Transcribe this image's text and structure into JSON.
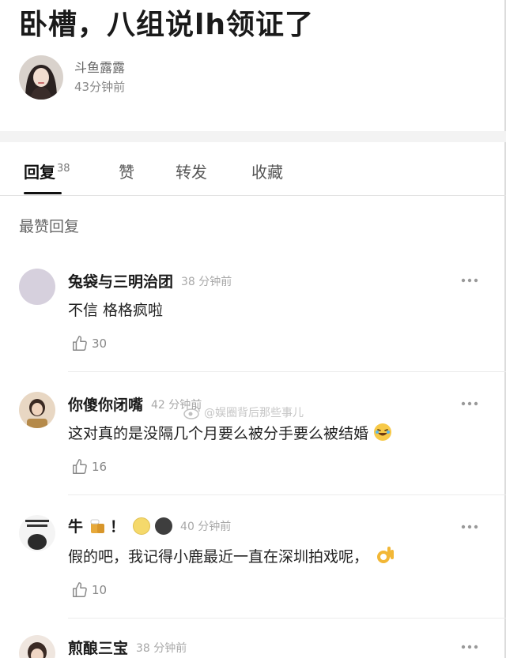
{
  "post": {
    "title": "卧槽，八组说lh领证了",
    "author_name": "斗鱼露露",
    "author_time": "43分钟前"
  },
  "tabs": [
    {
      "label": "回复",
      "count": "38"
    },
    {
      "label": "赞"
    },
    {
      "label": "转发"
    },
    {
      "label": "收藏"
    }
  ],
  "section_label": "最赞回复",
  "comments": [
    {
      "name": "兔袋与三明治团",
      "time": "38 分钟前",
      "text": "不信 格格疯啦",
      "likes": "30"
    },
    {
      "name": "你傻你闭嘴",
      "time": "42 分钟前",
      "text": "这对真的是没隔几个月要么被分手要么被结婚",
      "likes": "16"
    },
    {
      "name": "牛",
      "name_suffix": "！",
      "time": "40 分钟前",
      "text": "假的吧，我记得小鹿最近一直在深圳拍戏呢，",
      "likes": "10"
    },
    {
      "name": "煎酿三宝",
      "time": "38 分钟前"
    }
  ],
  "watermark": "@娱圈背后那些事儿",
  "colors": {
    "text_primary": "#1a1a1a",
    "text_secondary": "#888888",
    "divider": "#ececec",
    "gap": "#f3f3f3"
  }
}
